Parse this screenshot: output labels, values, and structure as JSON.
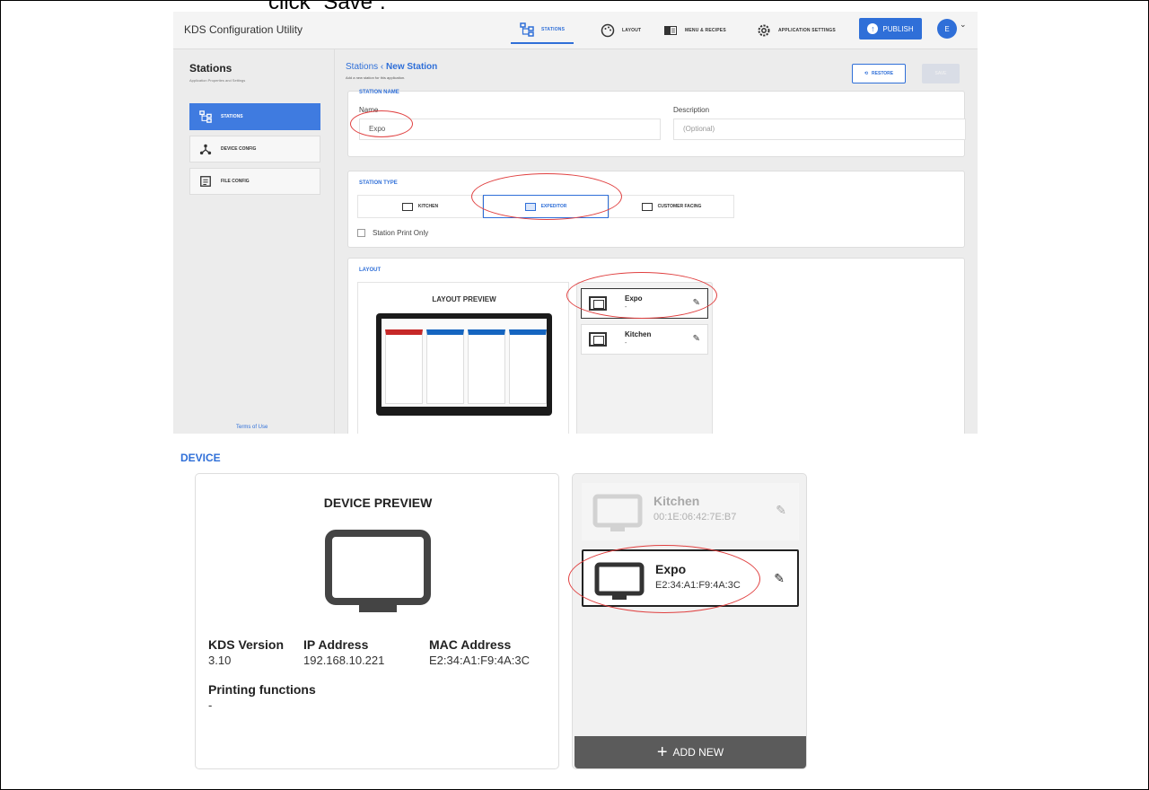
{
  "caption": "click “Save”.",
  "app": {
    "title": "KDS Configuration Utility",
    "nav": {
      "stations": "STATIONS",
      "layout": "LAYOUT",
      "menu": "MENU & RECIPES",
      "app_settings": "APPLICATION SETTINGS"
    },
    "publish": "PUBLISH",
    "avatar_initial": "E"
  },
  "sidebar": {
    "title": "Stations",
    "subtitle": "Application Properties and Settings",
    "items": [
      "STATIONS",
      "DEVICE CONFIG",
      "FILE CONFIG"
    ],
    "terms": "Terms of Use"
  },
  "main": {
    "breadcrumb_root": "Stations",
    "breadcrumb_sep": "‹",
    "breadcrumb_current": "New Station",
    "subtitle": "Add a new station for this application.",
    "restore": "RESTORE",
    "save": "SAVE"
  },
  "station_name": {
    "heading": "STATION NAME",
    "name_label": "Name",
    "name_value": "Expo",
    "desc_label": "Description",
    "desc_placeholder": "(Optional)"
  },
  "station_type": {
    "heading": "STATION TYPE",
    "tabs": [
      "KITCHEN",
      "EXPEDITOR",
      "CUSTOMER FACING"
    ],
    "selected": "EXPEDITOR",
    "print_only_label": "Station Print Only"
  },
  "layout": {
    "heading": "LAYOUT",
    "preview_title": "LAYOUT PREVIEW",
    "items": [
      {
        "name": "Expo",
        "sub": "-"
      },
      {
        "name": "Kitchen",
        "sub": "-"
      }
    ]
  },
  "device": {
    "heading": "DEVICE",
    "preview_title": "DEVICE PREVIEW",
    "kds_version_label": "KDS Version",
    "kds_version": "3.10",
    "ip_label": "IP Address",
    "ip": "192.168.10.221",
    "mac_label": "MAC Address",
    "mac": "E2:34:A1:F9:4A:3C",
    "printing_label": "Printing functions",
    "printing": "-",
    "list": [
      {
        "name": "Kitchen",
        "mac": "00:1E:06:42:7E:B7"
      },
      {
        "name": "Expo",
        "mac": "E2:34:A1:F9:4A:3C"
      }
    ],
    "add_new": "ADD NEW"
  },
  "colors": {
    "accent": "#2f6fd8",
    "annotation": "#e04040"
  }
}
